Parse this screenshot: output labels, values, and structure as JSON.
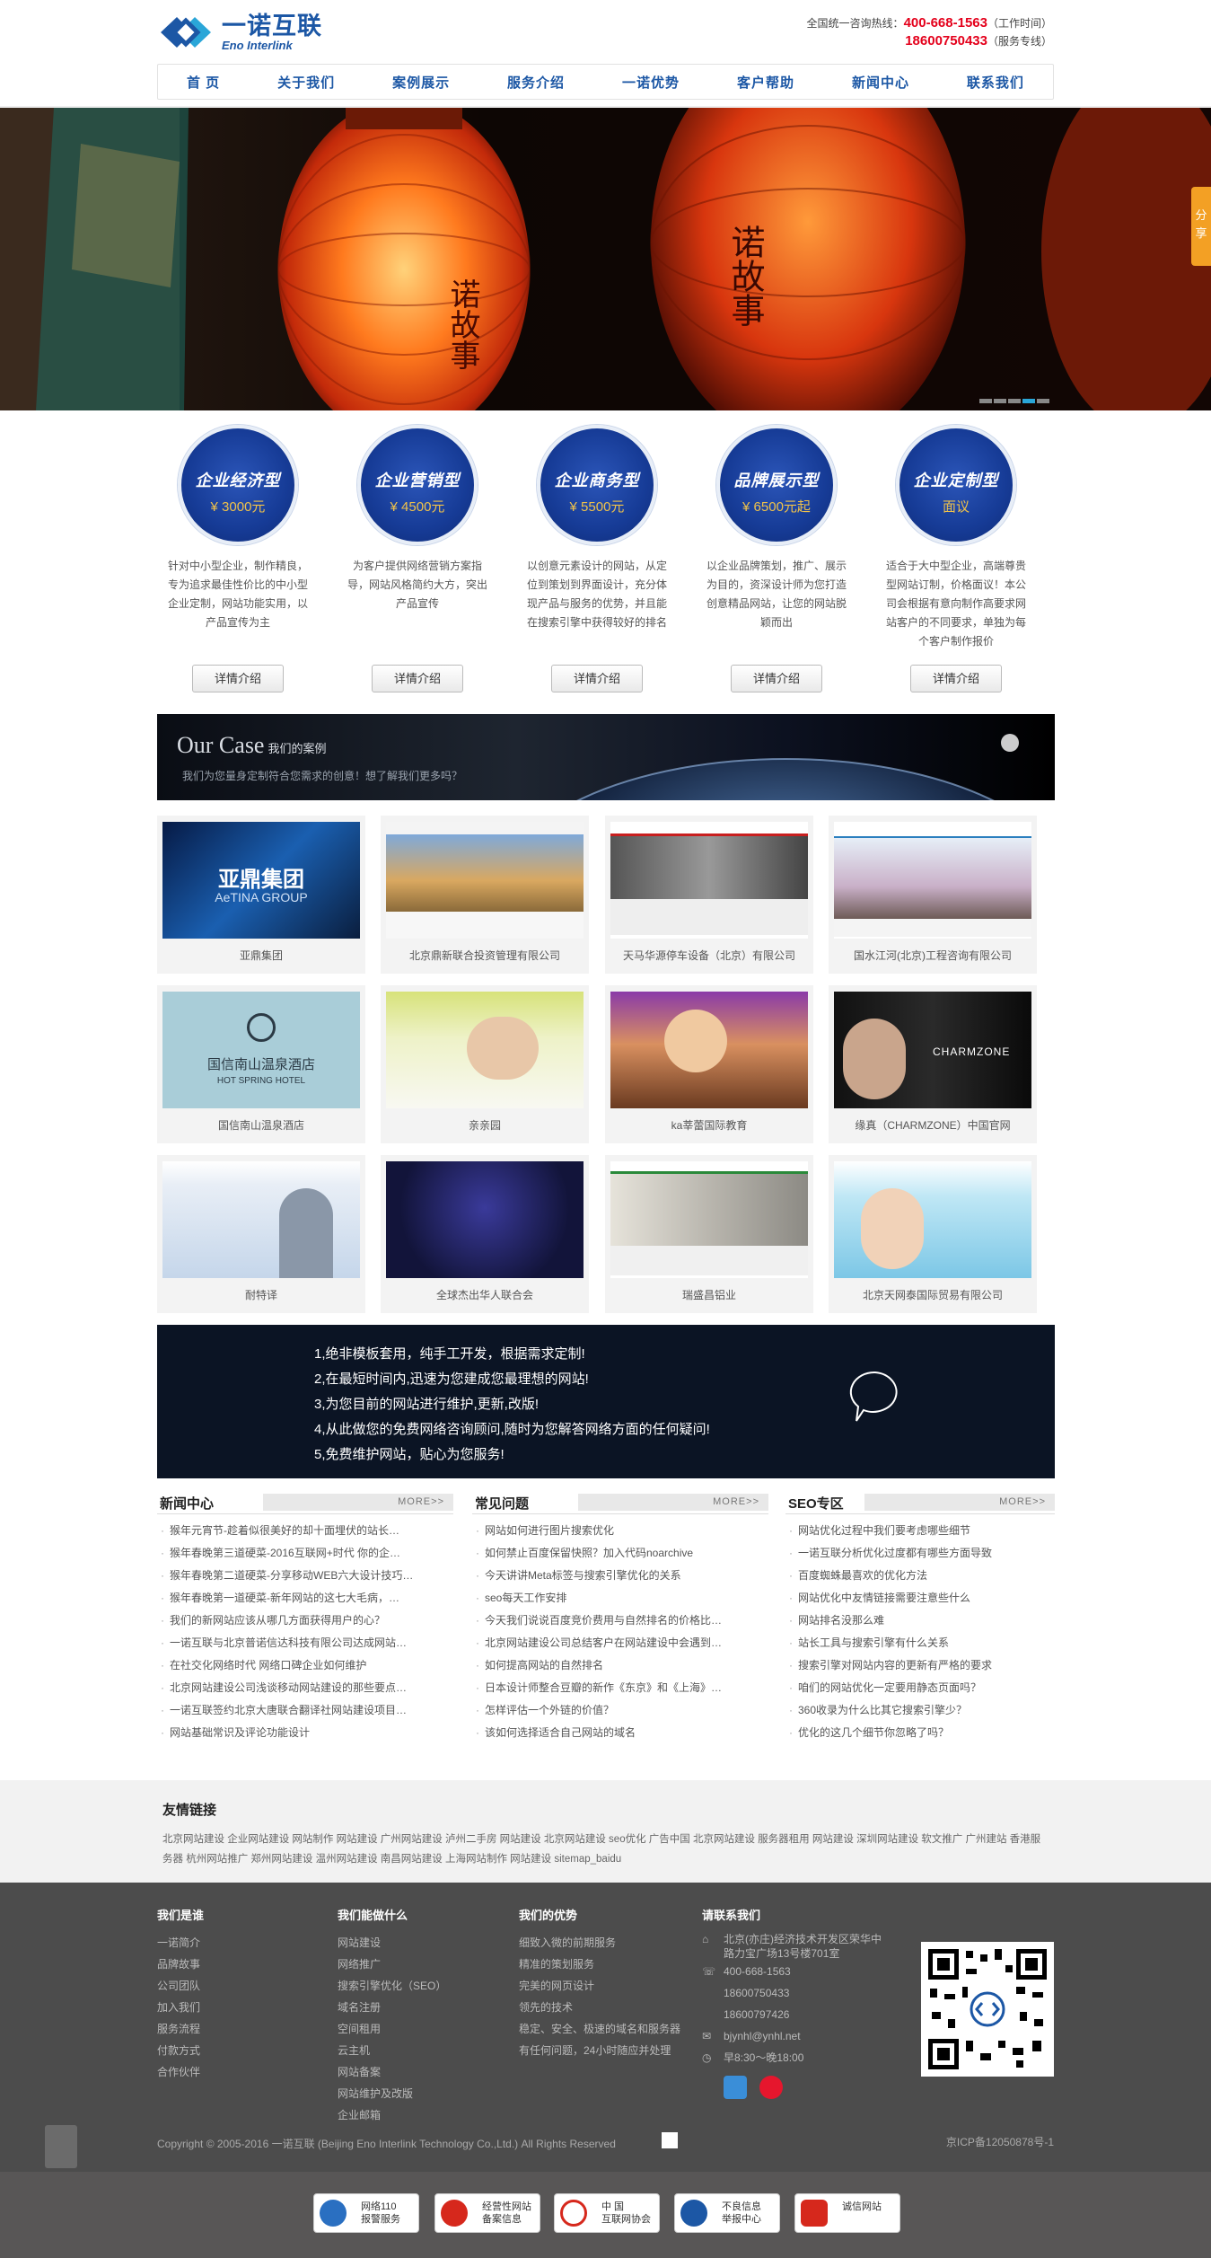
{
  "brand": {
    "cn": "一诺互联",
    "en": "Eno Interlink"
  },
  "hotline": {
    "label": "全国统一咨询热线：",
    "phone1": "400-668-1563",
    "note1": "（工作时间）",
    "phone2": "18600750433",
    "note2": "（服务专线）"
  },
  "nav": [
    "首 页",
    "关于我们",
    "案例展示",
    "服务介绍",
    "一诺优势",
    "客户帮助",
    "新闻中心",
    "联系我们"
  ],
  "share": "分享",
  "services": [
    {
      "title": "企业经济型",
      "price": "¥ 3000元",
      "desc": "针对中小型企业，制作精良，专为追求最佳性价比的中小型企业定制，网站功能实用，以产品宣传为主",
      "btn": "详情介绍"
    },
    {
      "title": "企业营销型",
      "price": "¥ 4500元",
      "desc": "为客户提供网络营销方案指导，网站风格简约大方，突出产品宣传",
      "btn": "详情介绍"
    },
    {
      "title": "企业商务型",
      "price": "¥ 5500元",
      "desc": "以创意元素设计的网站，从定位到策划到界面设计，充分体现产品与服务的优势，并且能在搜索引擎中获得较好的排名",
      "btn": "详情介绍"
    },
    {
      "title": "品牌展示型",
      "price": "¥ 6500元起",
      "desc": "以企业品牌策划，推广、展示为目的，资深设计师为您打造创意精品网站，让您的网站脱颖而出",
      "btn": "详情介绍"
    },
    {
      "title": "企业定制型",
      "price": "面议",
      "desc": "适合于大中型企业，高端尊贵型网站订制，价格面议！本公司会根据有意向制作高要求网站客户的不同要求，单独为每个客户制作报价",
      "btn": "详情介绍"
    }
  ],
  "case_head": {
    "title": "Our Case",
    "title_cn": "我们的案例",
    "sub": "我们为您量身定制符合您需求的创意！想了解我们更多吗？"
  },
  "cases": [
    "亚鼎集团",
    "北京鼎新联合投资管理有限公司",
    "天马华源停车设备（北京）有限公司",
    "国水江河(北京)工程咨询有限公司",
    "国信南山温泉酒店",
    "亲亲园",
    "ka莘蕾国际教育",
    "缘真（CHARMZONE）中国官网",
    "耐特译",
    "全球杰出华人联合会",
    "瑞盛昌铝业",
    "北京天网泰国际贸易有限公司"
  ],
  "case_img_text": {
    "c0": "亚鼎集团",
    "c0b": "AeTINA GROUP",
    "c4": "国信南山温泉酒店",
    "c4b": "HOT SPRING HOTEL",
    "c7": "CHARMZONE"
  },
  "promo": [
    "1,绝非模板套用，纯手工开发，根据需求定制!",
    "2,在最短时间内,迅速为您建成您最理想的网站!",
    "3,为您目前的网站进行维护,更新,改版!",
    "4,从此做您的免费网络咨询顾问,随时为您解答网络方面的任何疑问!",
    "5,免费维护网站，贴心为您服务!"
  ],
  "news": {
    "title": "新闻中心",
    "more": "MORE>>",
    "items": [
      "猴年元宵节-趁着似很美好的却十面埋伏的站长…",
      "猴年春晚第三道硬菜-2016互联网+时代 你的企…",
      "猴年春晚第二道硬菜-分享移动WEB六大设计技巧…",
      "猴年春晚第一道硬菜-新年网站的这七大毛病，…",
      "我们的新网站应该从哪几方面获得用户的心？",
      "一诺互联与北京普诺信达科技有限公司达成网站…",
      "在社交化网络时代 网络口碑企业如何维护",
      "北京网站建设公司浅谈移动网站建设的那些要点…",
      "一诺互联签约北京大唐联合翻译社网站建设项目…",
      "网站基础常识及评论功能设计"
    ]
  },
  "faq": {
    "title": "常见问题",
    "more": "MORE>>",
    "items": [
      "网站如何进行图片搜索优化",
      "如何禁止百度保留快照？加入代码noarchive",
      "今天讲讲Meta标签与搜索引擎优化的关系",
      "seo每天工作安排",
      "今天我们说说百度竞价费用与自然排名的价格比…",
      "北京网站建设公司总结客户在网站建设中会遇到…",
      "如何提高网站的自然排名",
      "日本设计师整合豆瓣的新作《东京》和《上海》…",
      "怎样评估一个外链的价值？",
      "该如何选择适合自己网站的域名"
    ]
  },
  "seo": {
    "title": "SEO专区",
    "more": "MORE>>",
    "items": [
      "网站优化过程中我们要考虑哪些细节",
      "一诺互联分析优化过度都有哪些方面导致",
      "百度蜘蛛最喜欢的优化方法",
      "网站优化中友情链接需要注意些什么",
      "网站排名没那么难",
      "站长工具与搜索引擎有什么关系",
      "搜索引擎对网站内容的更新有严格的要求",
      "咱们的网站优化一定要用静态页面吗？",
      "360收录为什么比其它搜索引擎少？",
      "优化的这几个细节你忽略了吗？"
    ]
  },
  "links": {
    "title": "友情链接",
    "items": "北京网站建设 企业网站建设 网站制作 网站建设 广州网站建设 泸州二手房 网站建设 北京网站建设 seo优化 广告中国 北京网站建设 服务器租用 网站建设 深圳网站建设 软文推广 广州建站 香港服务器 杭州网站推广 郑州网站建设 温州网站建设 南昌网站建设 上海网站制作 网站建设 sitemap_baidu"
  },
  "footer": {
    "col1": {
      "title": "我们是谁",
      "items": [
        "一诺简介",
        "品牌故事",
        "公司团队",
        "加入我们",
        "服务流程",
        "付款方式",
        "合作伙伴"
      ]
    },
    "col2": {
      "title": "我们能做什么",
      "items": [
        "网站建设",
        "网络推广",
        "搜索引擎优化（SEO）",
        "域名注册",
        "空间租用",
        "云主机",
        "网站备案",
        "网站维护及改版",
        "企业邮箱"
      ]
    },
    "col3": {
      "title": "我们的优势",
      "items": [
        "细致入微的前期服务",
        "精准的策划服务",
        "完美的网页设计",
        "领先的技术",
        "稳定、安全、极速的域名和服务器",
        "有任何问题，24小时随应并处理"
      ]
    },
    "col4": {
      "title": "请联系我们",
      "address": "北京(亦庄)经济技术开发区荣华中路力宝广场13号楼701室",
      "phone": "400-668-1563",
      "mobile1": "18600750433",
      "mobile2": "18600797426",
      "email": "bjynhl@ynhl.net",
      "hours": "早8:30～晚18:00"
    },
    "copyright": "Copyright © 2005-2016 一诺互联 (Beijing Eno Interlink Technology Co.,Ltd.) All Rights Reserved",
    "icp": "京ICP备12050878号-1"
  },
  "badges": [
    {
      "l1": "网络110",
      "l2": "报警服务"
    },
    {
      "l1": "经营性网站",
      "l2": "备案信息"
    },
    {
      "l1": "中 国",
      "l2": "互联网协会"
    },
    {
      "l1": "不良信息",
      "l2": "举报中心"
    },
    {
      "l1": "诚信网站",
      "l2": ""
    }
  ]
}
